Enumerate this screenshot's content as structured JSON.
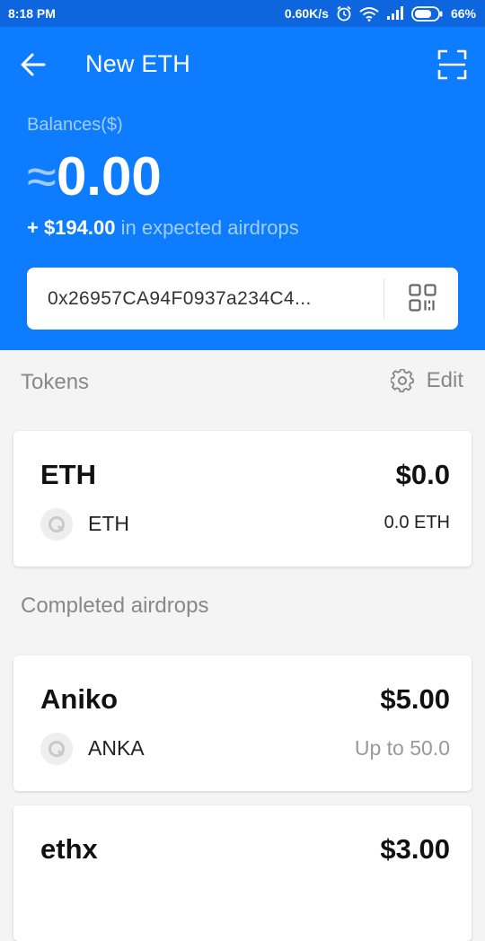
{
  "status_bar": {
    "time": "8:18 PM",
    "speed": "0.60K/s",
    "battery": "66%",
    "icons": [
      "alarm-icon",
      "wifi-icon",
      "signal-icon",
      "battery-icon"
    ]
  },
  "header": {
    "title": "New ETH",
    "balance_label": "Balances($)",
    "balance_prefix": "≈",
    "balance_value": "0.00",
    "airdrop_amount": "+ $194.00",
    "airdrop_text": " in expected airdrops",
    "address": "0x26957CA94F0937a234C4...",
    "color": "#0d7cff"
  },
  "tokens_section": {
    "title": "Tokens",
    "edit_label": "Edit"
  },
  "tokens": [
    {
      "name": "ETH",
      "value": "$0.0",
      "symbol": "ETH",
      "amount": "0.0 ETH"
    }
  ],
  "airdrops_section": {
    "title": "Completed airdrops"
  },
  "airdrops": [
    {
      "name": "Aniko",
      "value": "$5.00",
      "symbol": "ANKA",
      "amount": "Up to 50.0"
    },
    {
      "name": "ethx",
      "value": "$3.00"
    }
  ]
}
